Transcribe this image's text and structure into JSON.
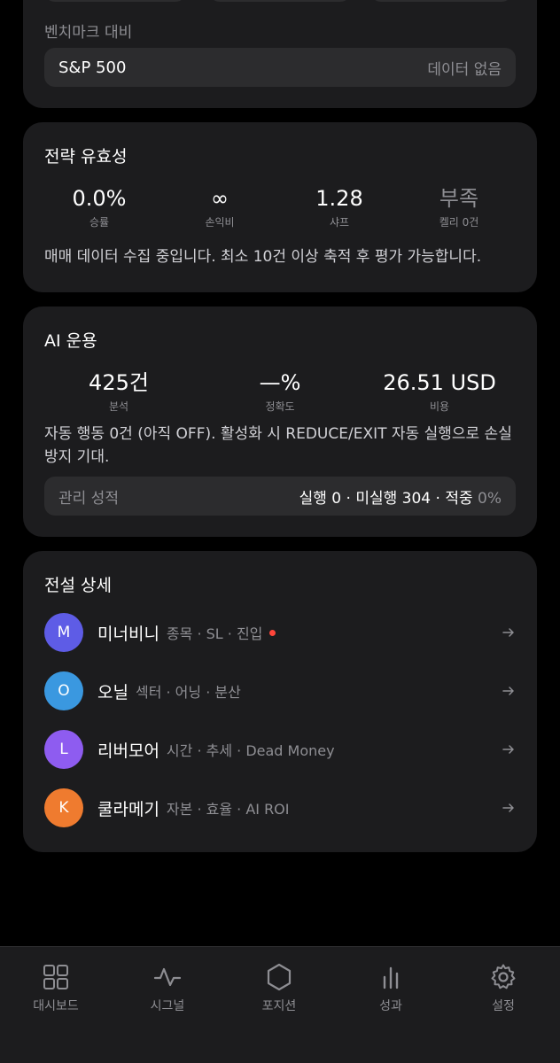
{
  "benchmark": {
    "section_label": "벤치마크 대비",
    "name": "S&P 500",
    "value": "데이터 없음"
  },
  "strategy": {
    "title": "전략 유효성",
    "stats": [
      {
        "value": "0.0%",
        "label": "승률"
      },
      {
        "value": "∞",
        "label": "손익비"
      },
      {
        "value": "1.28",
        "label": "샤프"
      },
      {
        "value": "부족",
        "label": "켈리 0건"
      }
    ],
    "note": "매매 데이터 수집 중입니다. 최소 10건 이상 축적 후 평가 가능합니다."
  },
  "ai": {
    "title": "AI 운용",
    "stats": [
      {
        "value": "425건",
        "label": "분석"
      },
      {
        "value": "—%",
        "label": "정확도"
      },
      {
        "value": "26.51 USD",
        "label": "비용"
      }
    ],
    "note": "자동 행동 0건 (아직 OFF). 활성화 시 REDUCE/EXIT 자동 실행으로 손실 방지 기대.",
    "management": {
      "label": "관리 성적",
      "value_main": "실행 0 · 미실행 304 · 적중",
      "value_pct": "0%"
    }
  },
  "legends": {
    "title": "전설 상세",
    "items": [
      {
        "initial": "M",
        "name": "미너비니",
        "tags": "종목 · SL · 진입",
        "color": "#5e5ce6",
        "alert": true
      },
      {
        "initial": "O",
        "name": "오닐",
        "tags": "섹터 · 어닝 · 분산",
        "color": "#3a98e0",
        "alert": false
      },
      {
        "initial": "L",
        "name": "리버모어",
        "tags": "시간 · 추세 · Dead Money",
        "color": "#8e5cf0",
        "alert": false
      },
      {
        "initial": "K",
        "name": "쿨라메기",
        "tags": "자본 · 효율 · AI ROI",
        "color": "#ef7b2f",
        "alert": false
      }
    ]
  },
  "tabbar": {
    "tabs": [
      {
        "label": "대시보드",
        "icon": "grid-icon"
      },
      {
        "label": "시그널",
        "icon": "pulse-icon"
      },
      {
        "label": "포지션",
        "icon": "hexagon-icon"
      },
      {
        "label": "성과",
        "icon": "bar-chart-icon"
      },
      {
        "label": "설정",
        "icon": "gear-icon"
      }
    ]
  }
}
